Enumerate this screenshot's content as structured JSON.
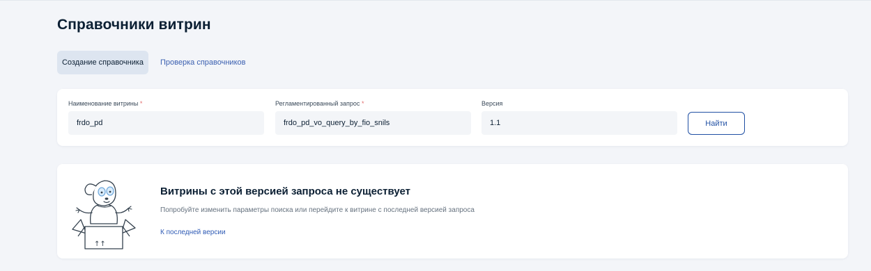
{
  "page": {
    "title": "Справочники витрин"
  },
  "tabs": [
    {
      "label": "Создание справочника",
      "active": true
    },
    {
      "label": "Проверка справочников",
      "active": false
    }
  ],
  "search": {
    "fields": [
      {
        "label": "Наименование витрины",
        "required": "*",
        "value": "frdo_pd"
      },
      {
        "label": "Регламентированный запрос",
        "required": "*",
        "value": "frdo_pd_vo_query_by_fio_snils"
      },
      {
        "label": "Версия",
        "required": "",
        "value": "1.1"
      }
    ],
    "find_label": "Найти"
  },
  "empty_state": {
    "title": "Витрины с этой версией запроса не существует",
    "description": "Попробуйте изменить параметры поиска или перейдите к витрине с последней версией запроса",
    "link": "К последней версии",
    "illustration_icon": "dog-in-box-icon",
    "box_glyph": "↑↑"
  },
  "colors": {
    "background": "#f3f5f9",
    "card": "#ffffff",
    "accent": "#1f4fa3",
    "link": "#3a5fb0",
    "text": "#0b1f33",
    "muted": "#66727f"
  }
}
